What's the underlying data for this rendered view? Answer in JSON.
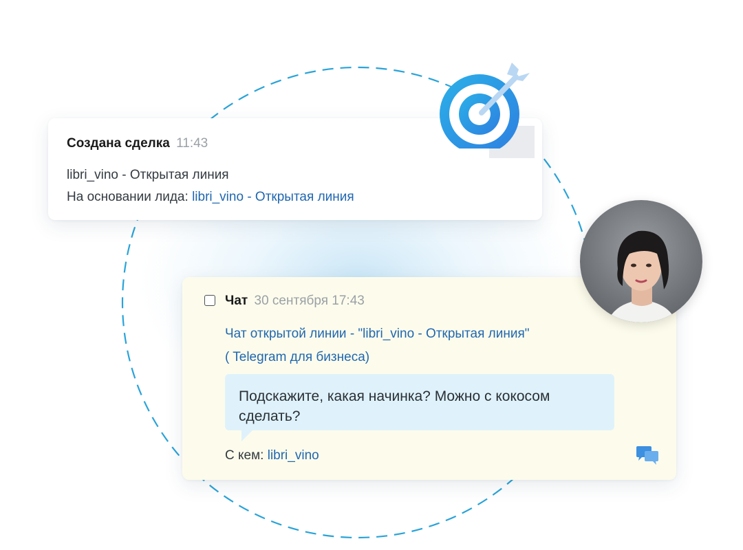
{
  "deal_card": {
    "title": "Создана сделка",
    "time": "11:43",
    "line1": "libri_vino - Открытая линия",
    "line2_prefix": "На основании лида: ",
    "line2_link": "libri_vino - Открытая линия"
  },
  "chat_card": {
    "title": "Чат",
    "datetime": "30 сентября 17:43",
    "link_line1": "Чат открытой линии - \"libri_vino - Открытая линия\"",
    "link_line2": "( Telegram для бизнеса)",
    "message": "Подскажите, какая начинка? Можно с кокосом сделать?",
    "with_prefix": "С кем: ",
    "with_name": "libri_vino"
  },
  "icons": {
    "target": "target-arrow-icon",
    "chat": "chat-bubbles-icon",
    "avatar": "user-avatar"
  },
  "colors": {
    "link": "#2067b0",
    "dashed_ring": "#29a3d8",
    "target_blue": "#2a8fe0",
    "chat_bg": "#fdfcec",
    "bubble_bg": "#dff2fb"
  }
}
